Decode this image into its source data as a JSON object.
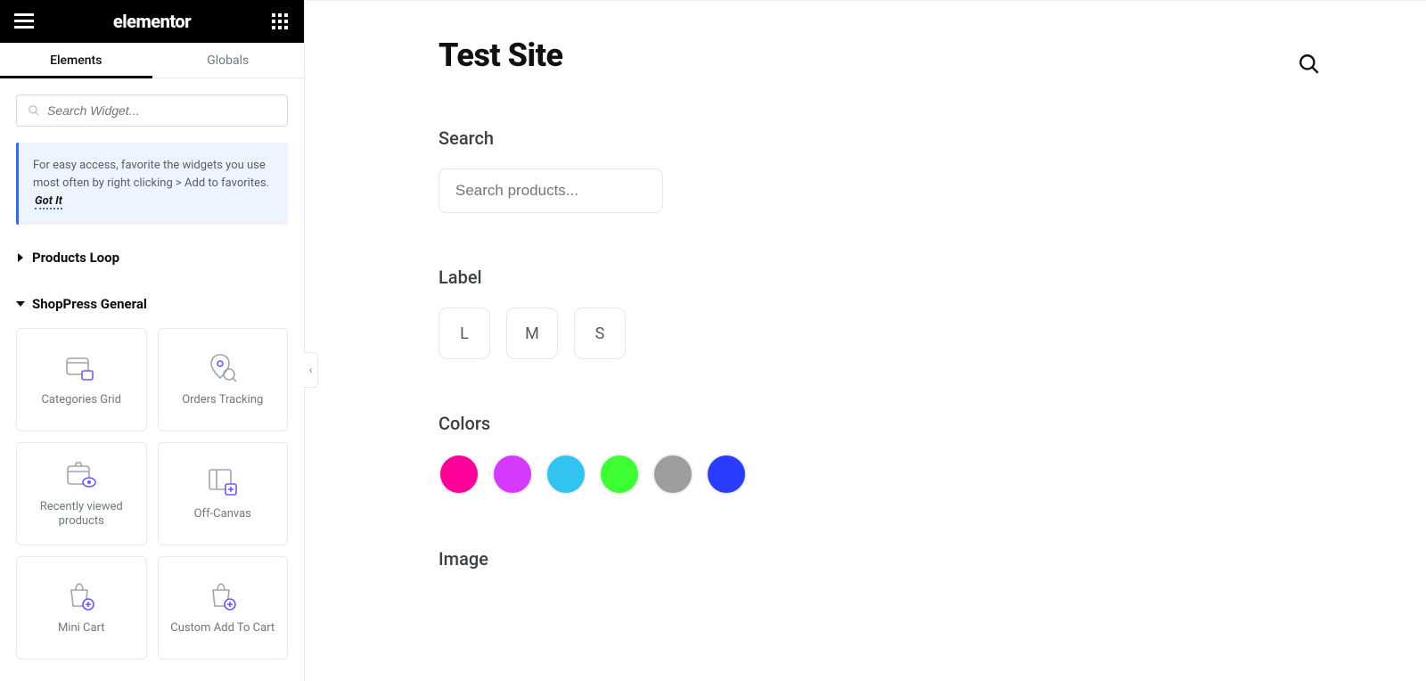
{
  "header": {
    "logo": "elementor"
  },
  "tabs": {
    "elements": "Elements",
    "globals": "Globals"
  },
  "search": {
    "placeholder": "Search Widget..."
  },
  "tip": {
    "text": "For easy access, favorite the widgets you use most often by right clicking > Add to favorites.",
    "gotit": "Got It"
  },
  "sections": {
    "products_loop": {
      "title": "Products Loop",
      "expanded": false
    },
    "shoppress_general": {
      "title": "ShopPress General",
      "expanded": true,
      "widgets": [
        {
          "id": "categories-grid",
          "label": "Categories Grid"
        },
        {
          "id": "orders-tracking",
          "label": "Orders Tracking"
        },
        {
          "id": "recently-viewed",
          "label": "Recently viewed products"
        },
        {
          "id": "off-canvas",
          "label": "Off-Canvas"
        },
        {
          "id": "mini-cart",
          "label": "Mini Cart"
        },
        {
          "id": "custom-add-to-cart",
          "label": "Custom Add To Cart"
        }
      ]
    }
  },
  "preview": {
    "site_title": "Test Site",
    "blocks": {
      "search": {
        "title": "Search",
        "placeholder": "Search products..."
      },
      "label": {
        "title": "Label",
        "options": [
          "L",
          "M",
          "S"
        ]
      },
      "colors": {
        "title": "Colors",
        "swatches": [
          "#ff0099",
          "#d63aff",
          "#33c3f0",
          "#3dff33",
          "#9e9e9e",
          "#2a3dff"
        ]
      },
      "image": {
        "title": "Image"
      }
    }
  },
  "icons": {
    "hamburger": "hamburger-icon",
    "apps": "apps-grid-icon",
    "search": "search-icon",
    "collapse": "chevron-left-icon"
  }
}
